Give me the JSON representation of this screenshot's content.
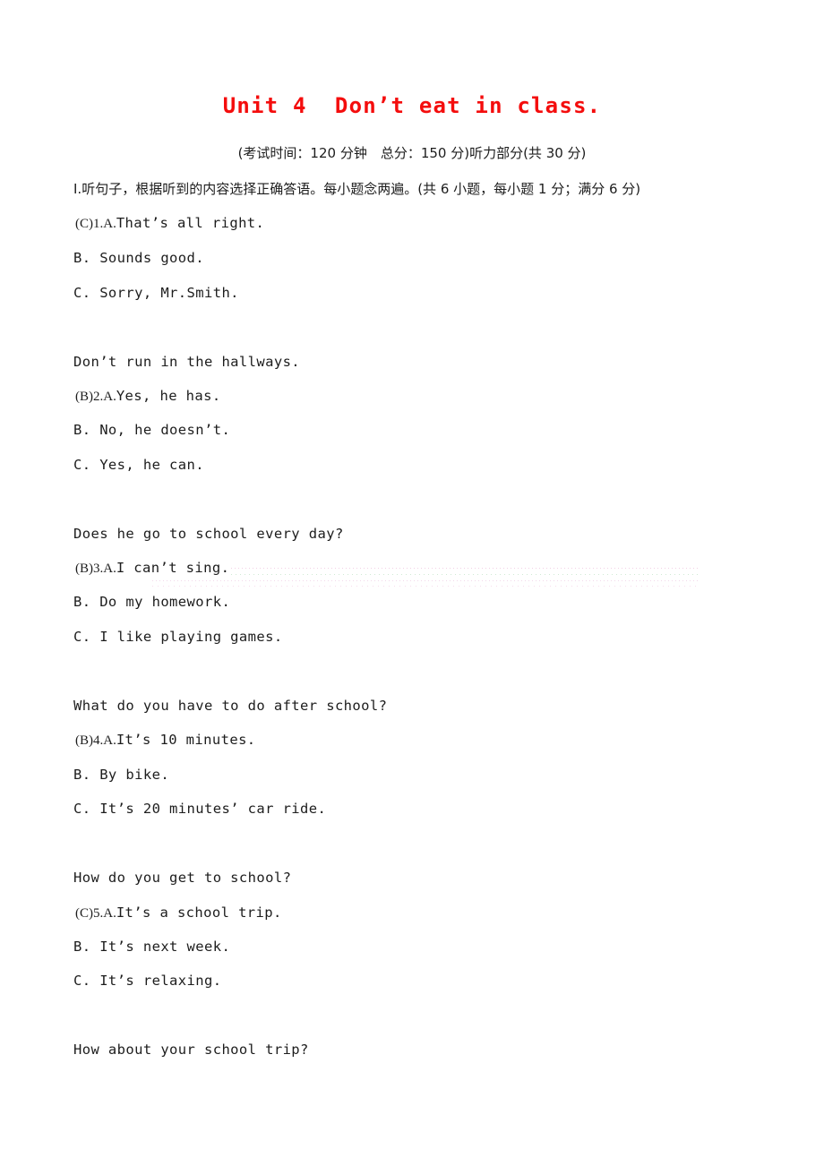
{
  "document": {
    "title": "Unit 4  Don’t eat in class.",
    "title_color": "#f40d0d",
    "subtitle": "(考试时间：120 分钟　总分：150 分)听力部分(共 30 分)",
    "section_instruction": "Ⅰ.听句子，根据听到的内容选择正确答语。每小题念两遍。(共 6 小题，每小题 1 分；满分 6 分)"
  },
  "questions": [
    {
      "answer_marker": "(C)1.A.",
      "first_option_text": "That’s all right.",
      "options": [
        "B. Sounds good.",
        "C. Sorry, Mr.Smith."
      ],
      "prompt_after": "Don’t run in the hallways."
    },
    {
      "answer_marker": "(B)2.A.",
      "first_option_text": "Yes, he has.",
      "options": [
        "B. No, he doesn’t.",
        "C. Yes, he can."
      ],
      "prompt_after": "Does he go to school every day?"
    },
    {
      "answer_marker": "(B)3.A.",
      "first_option_text": "I can’t sing.",
      "options": [
        "B. Do my homework.",
        "C. I like playing games."
      ],
      "prompt_after": "What do you have to do after school?"
    },
    {
      "answer_marker": "(B)4.A.",
      "first_option_text": "It’s 10 minutes.",
      "options": [
        "B. By bike.",
        "C. It’s 20 minutes’ car ride."
      ],
      "prompt_after": "How do you get to school?"
    },
    {
      "answer_marker": "(C)5.A.",
      "first_option_text": "It’s a school trip.",
      "options": [
        "B. It’s next week.",
        "C. It’s relaxing."
      ],
      "prompt_after": "How about your school trip?"
    }
  ]
}
